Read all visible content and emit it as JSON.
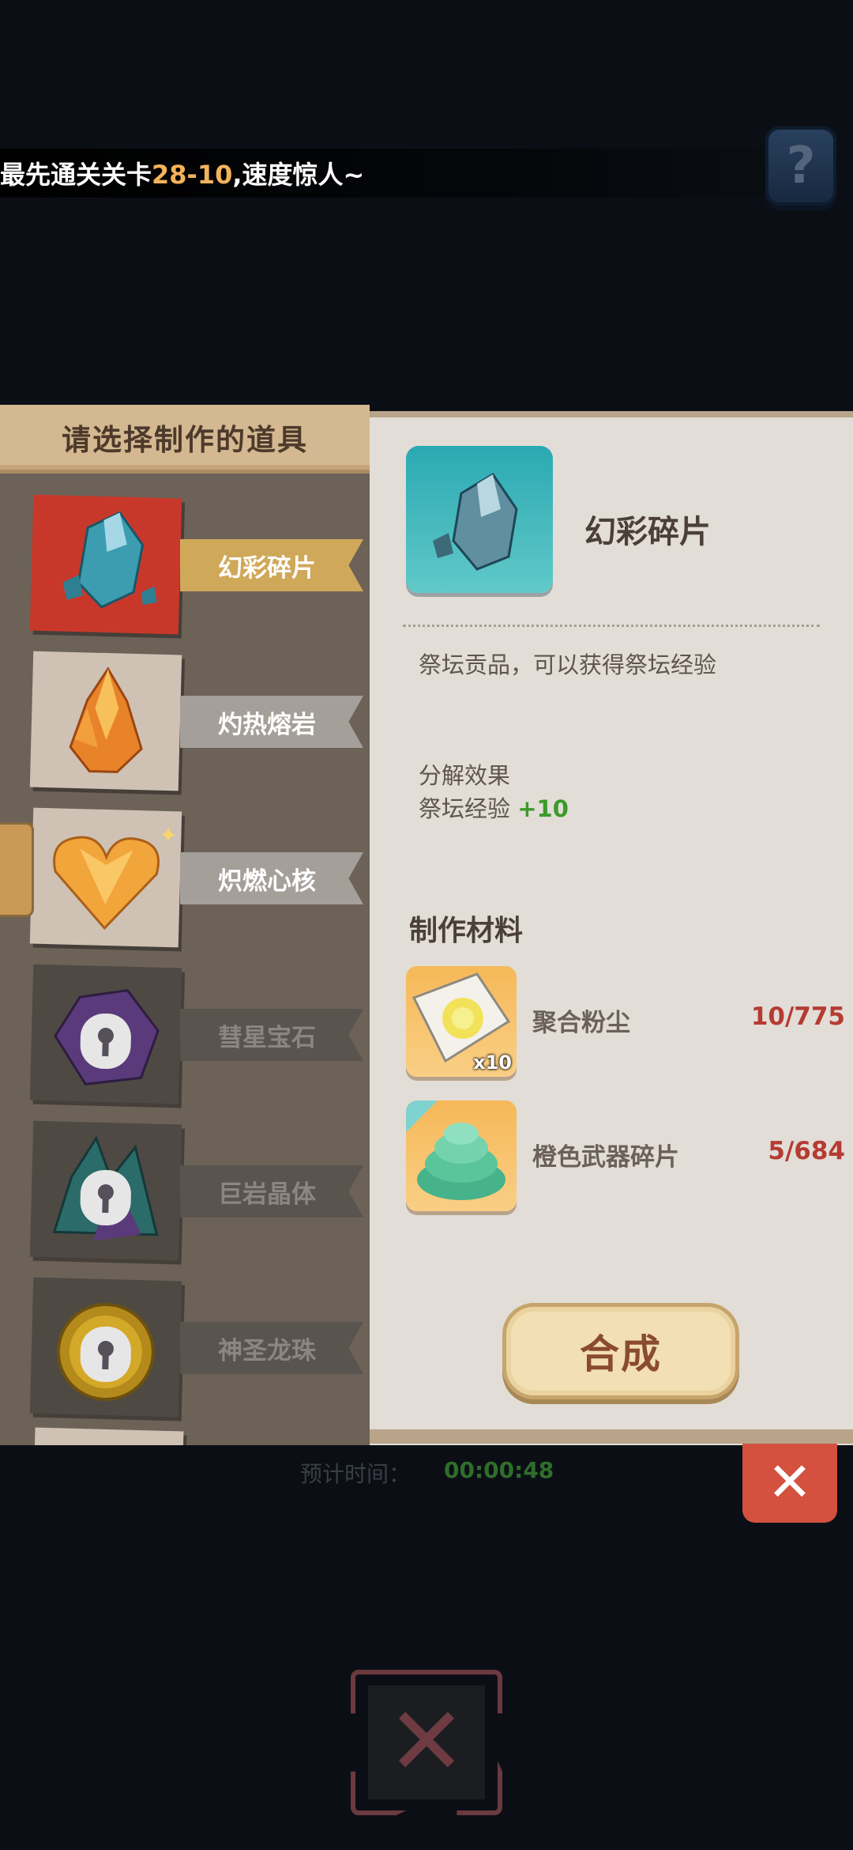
{
  "marquee": {
    "prefix": "最先通关关卡",
    "highlight": "28-10",
    "suffix": ",速度惊人~"
  },
  "help_button": {
    "icon": "question-icon",
    "label": "?"
  },
  "left_panel": {
    "title": "请选择制作的道具",
    "items": [
      {
        "name": "幻彩碎片",
        "icon": "crystal-shards-icon",
        "state": "selected"
      },
      {
        "name": "灼热熔岩",
        "icon": "lava-crystal-icon",
        "state": "unlocked"
      },
      {
        "name": "炽燃心核",
        "icon": "heart-core-icon",
        "state": "unlocked"
      },
      {
        "name": "彗星宝石",
        "icon": "comet-gem-icon",
        "state": "locked"
      },
      {
        "name": "巨岩晶体",
        "icon": "rock-crystal-icon",
        "state": "locked"
      },
      {
        "name": "神圣龙珠",
        "icon": "dragon-orb-icon",
        "state": "locked"
      }
    ]
  },
  "detail": {
    "item_name": "幻彩碎片",
    "description": "祭坛贡品，可以获得祭坛经验",
    "decompose_title": "分解效果",
    "decompose_label": "祭坛经验",
    "decompose_value": "+10",
    "materials_title": "制作材料",
    "materials": [
      {
        "name": "聚合粉尘",
        "count": "10/775",
        "qty_badge": "x10",
        "icon": "dust-icon"
      },
      {
        "name": "橙色武器碎片",
        "count": "5/684",
        "qty_badge": "",
        "icon": "weapon-shards-icon"
      }
    ],
    "craft_button": "合成"
  },
  "background": {
    "estimate_label": "预计时间：",
    "estimate_time": "00:00:48"
  },
  "colors": {
    "accent_gold": "#f4b25a",
    "count_red": "#b53b33",
    "plus_green": "#3b9a2a",
    "close_red": "#d3513e"
  }
}
